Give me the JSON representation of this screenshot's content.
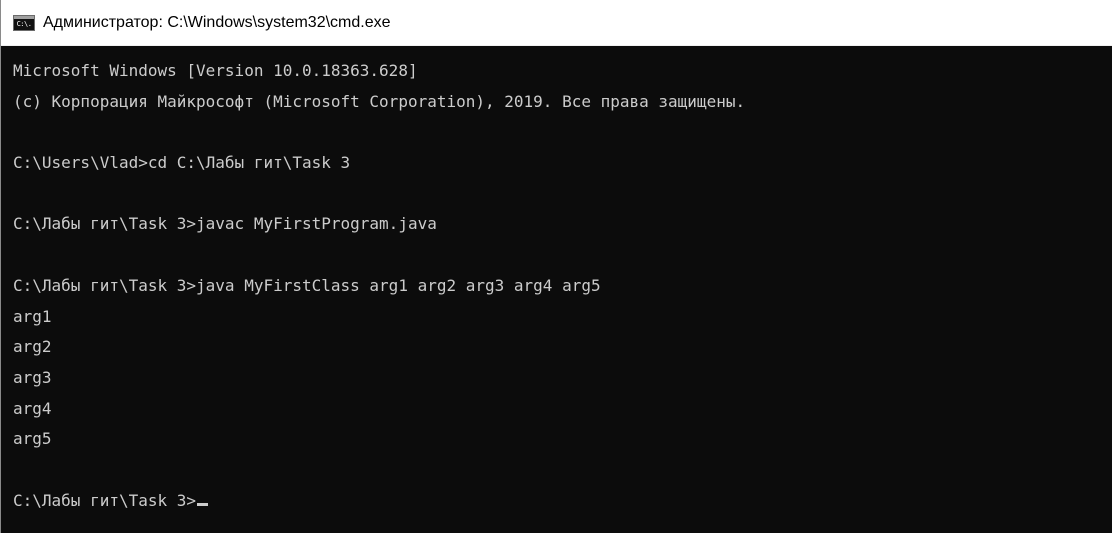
{
  "window": {
    "title": "Администратор: C:\\Windows\\system32\\cmd.exe",
    "icon": "cmd-console-icon",
    "icon_text": "C:\\."
  },
  "console": {
    "lines": [
      "Microsoft Windows [Version 10.0.18363.628]",
      "(c) Корпорация Майкрософт (Microsoft Corporation), 2019. Все права защищены.",
      "",
      "C:\\Users\\Vlad>cd C:\\Лабы гит\\Task 3",
      "",
      "C:\\Лабы гит\\Task 3>javac MyFirstProgram.java",
      "",
      "C:\\Лабы гит\\Task 3>java MyFirstClass arg1 arg2 arg3 arg4 arg5",
      "arg1",
      "arg2",
      "arg3",
      "arg4",
      "arg5",
      "",
      "C:\\Лабы гит\\Task 3>"
    ]
  },
  "colors": {
    "background": "#0c0c0c",
    "text": "#cccccc",
    "titlebar": "#ffffff"
  }
}
